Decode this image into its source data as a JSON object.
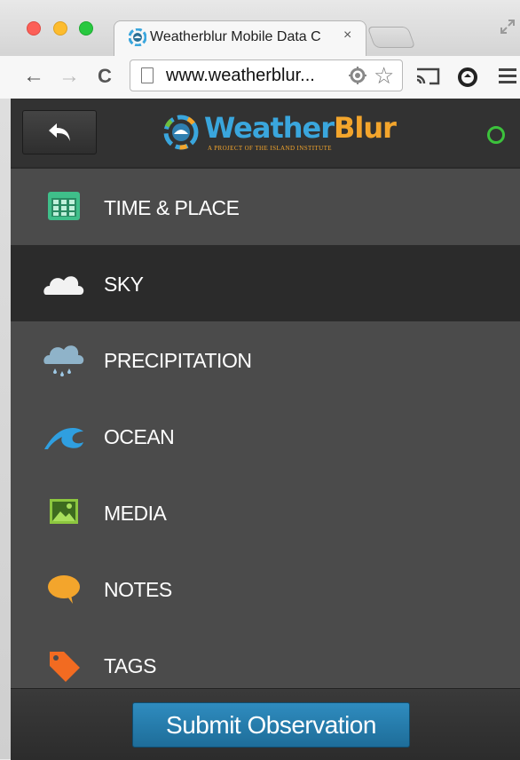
{
  "browser": {
    "tab_title": "Weatherblur Mobile Data C",
    "tab_close": "×",
    "url": "www.weatherblur...",
    "back": "←",
    "forward": "→",
    "reload": "C",
    "star": "☆"
  },
  "app": {
    "logo_part1": "Weather",
    "logo_part2": "Blur",
    "logo_subtitle": "A PROJECT OF THE ISLAND INSTITUTE",
    "status_color": "#3cc23c",
    "menu": [
      {
        "label": "TIME & PLACE",
        "icon": "calendar-icon",
        "active": false
      },
      {
        "label": "SKY",
        "icon": "cloud-icon",
        "active": true
      },
      {
        "label": "PRECIPITATION",
        "icon": "rain-cloud-icon",
        "active": false
      },
      {
        "label": "OCEAN",
        "icon": "wave-icon",
        "active": false
      },
      {
        "label": "MEDIA",
        "icon": "image-icon",
        "active": false
      },
      {
        "label": "NOTES",
        "icon": "speech-bubble-icon",
        "active": false
      },
      {
        "label": "TAGS",
        "icon": "tag-icon",
        "active": false
      }
    ],
    "submit_label": "Submit Observation"
  }
}
